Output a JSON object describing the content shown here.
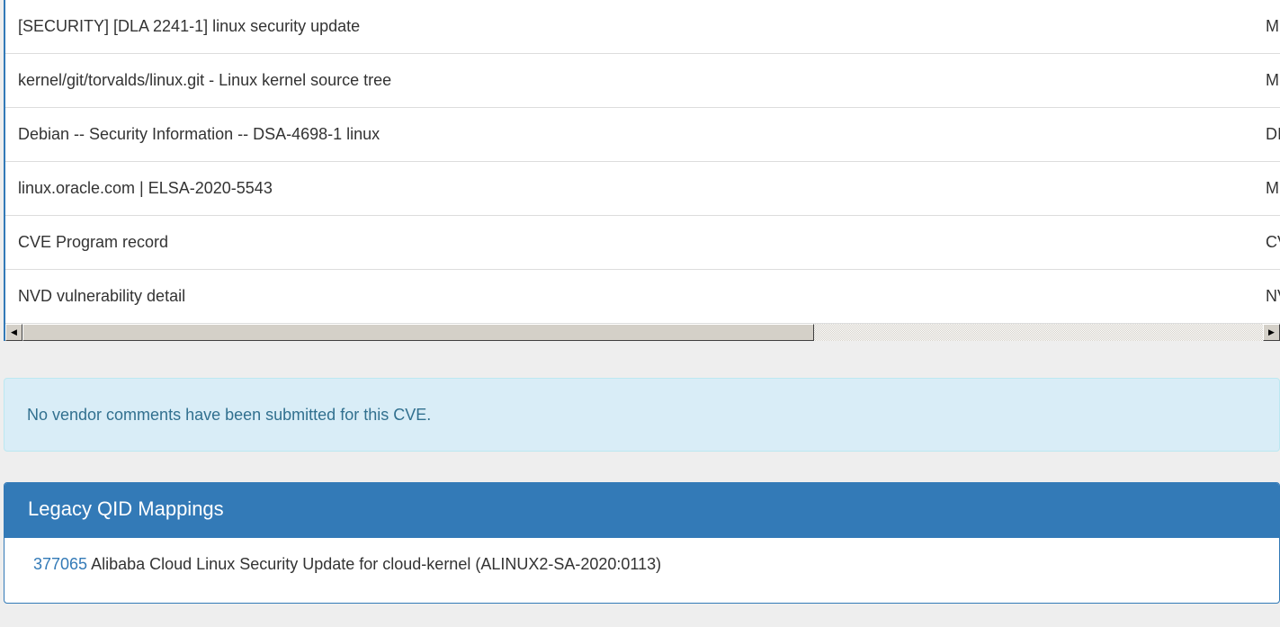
{
  "references": [
    {
      "title": "[SECURITY] [DLA 2241-1] linux security update",
      "source": "M"
    },
    {
      "title": "kernel/git/torvalds/linux.git - Linux kernel source tree",
      "source": "M"
    },
    {
      "title": "Debian -- Security Information -- DSA-4698-1 linux",
      "source": "DI"
    },
    {
      "title": "linux.oracle.com | ELSA-2020-5543",
      "source": "M"
    },
    {
      "title": "CVE Program record",
      "source": "CV"
    },
    {
      "title": "NVD vulnerability detail",
      "source": "NV"
    }
  ],
  "scrollbar": {
    "left_arrow": "◀",
    "right_arrow": "▶"
  },
  "vendor_comments": {
    "message": "No vendor comments have been submitted for this CVE."
  },
  "legacy_qid": {
    "heading": "Legacy QID Mappings",
    "items": [
      {
        "qid": "377065",
        "description": "Alibaba Cloud Linux Security Update for cloud-kernel (ALINUX2-SA-2020:0113)"
      }
    ]
  },
  "colors": {
    "primary": "#337ab7",
    "info_bg": "#d9edf7",
    "info_text": "#31708f",
    "page_bg": "#eeeeee"
  }
}
